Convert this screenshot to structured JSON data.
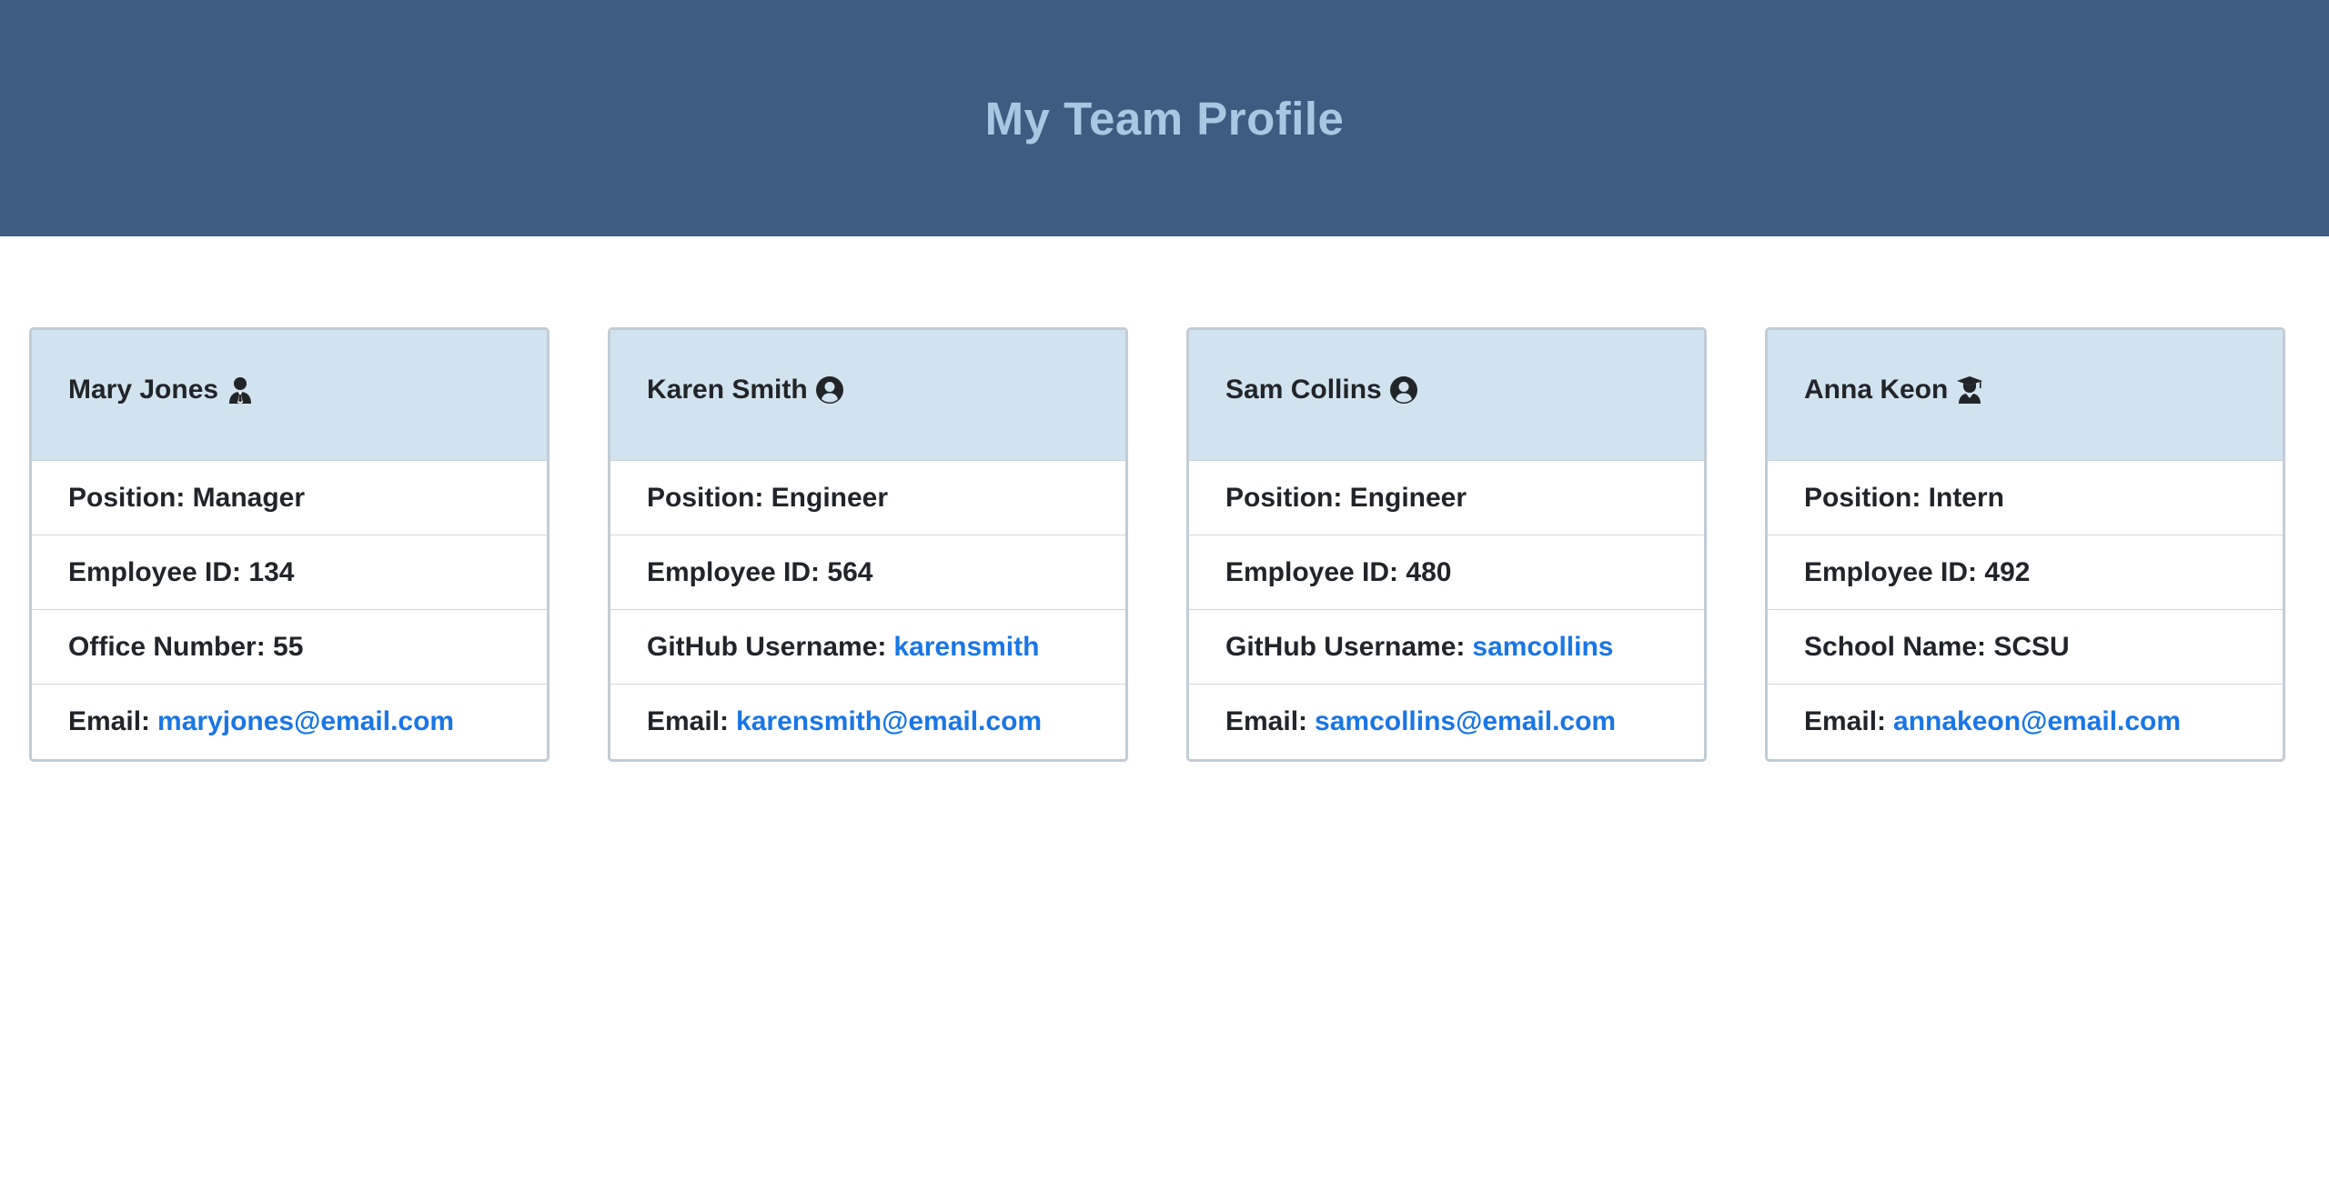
{
  "header": {
    "title": "My Team Profile"
  },
  "cards": [
    {
      "name": "Mary Jones",
      "icon": "manager-icon",
      "position": "Position: Manager",
      "id": "Employee ID: 134",
      "third_label": "Office Number: 55",
      "third_link": "",
      "email_label": "Email:",
      "email": "maryjones@email.com"
    },
    {
      "name": "Karen Smith",
      "icon": "user-circle-icon",
      "position": "Position: Engineer",
      "id": "Employee ID: 564",
      "third_label": "GitHub Username:",
      "third_link": "karensmith",
      "email_label": "Email:",
      "email": "karensmith@email.com"
    },
    {
      "name": "Sam Collins",
      "icon": "user-circle-icon",
      "position": "Position: Engineer",
      "id": "Employee ID: 480",
      "third_label": "GitHub Username:",
      "third_link": "samcollins",
      "email_label": "Email:",
      "email": "samcollins@email.com"
    },
    {
      "name": "Anna Keon",
      "icon": "graduate-icon",
      "position": "Position: Intern",
      "id": "Employee ID: 492",
      "third_label": "School Name: SCSU",
      "third_link": "",
      "email_label": "Email:",
      "email": "annakeon@email.com"
    }
  ],
  "colors": {
    "header_bg": "#3e5c81",
    "header_text": "#a7c7e3",
    "card_header_bg": "#d1e3ef",
    "link": "#1976e6"
  }
}
